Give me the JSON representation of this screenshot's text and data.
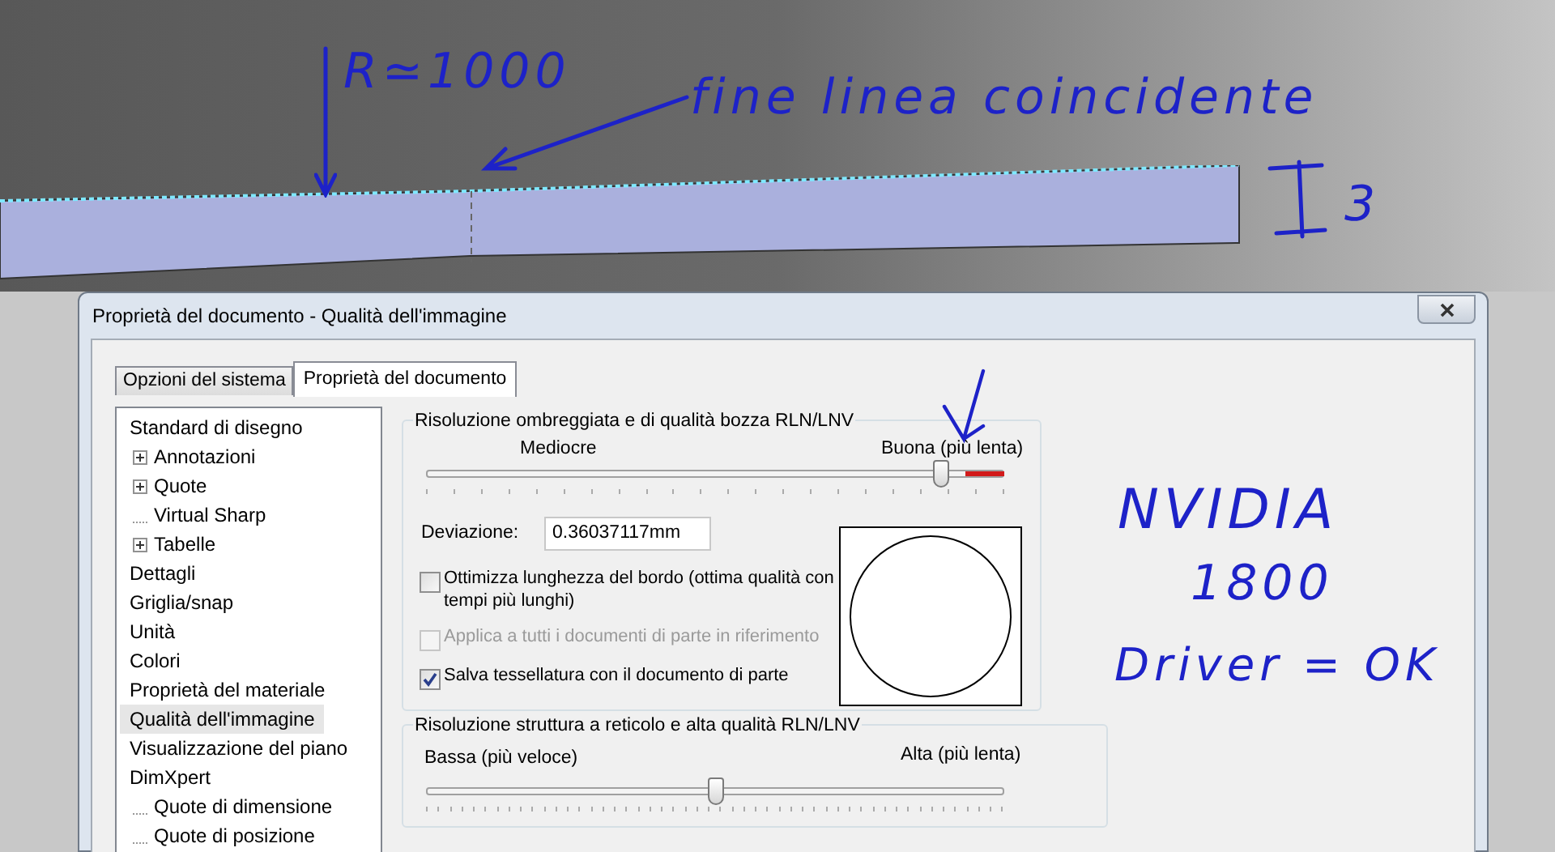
{
  "viewport_annotations": [
    "R≃1000",
    "fine linea coincidente",
    "3"
  ],
  "side_annotations": [
    "NVIDIA",
    "1800",
    "Driver = OK"
  ],
  "dialog": {
    "title": "Proprietà del documento - Qualità dell'immagine",
    "tabs": [
      {
        "label": "Opzioni del sistema",
        "selected": false
      },
      {
        "label": "Proprietà del documento",
        "selected": true
      }
    ],
    "tree": [
      {
        "label": "Standard di disegno",
        "selected": false,
        "children": [
          {
            "label": "Annotazioni",
            "kind": "collapsed"
          },
          {
            "label": "Quote",
            "kind": "collapsed"
          },
          {
            "label": "Virtual Sharp",
            "kind": "leaf"
          },
          {
            "label": "Tabelle",
            "kind": "collapsed"
          }
        ]
      },
      {
        "label": "Dettagli",
        "selected": false
      },
      {
        "label": "Griglia/snap",
        "selected": false
      },
      {
        "label": "Unità",
        "selected": false
      },
      {
        "label": "Colori",
        "selected": false
      },
      {
        "label": "Proprietà del materiale",
        "selected": false
      },
      {
        "label": "Qualità dell'immagine",
        "selected": true
      },
      {
        "label": "Visualizzazione del piano",
        "selected": false
      },
      {
        "label": "DimXpert",
        "selected": false,
        "children": [
          {
            "label": "Quote di dimensione",
            "kind": "leaf"
          },
          {
            "label": "Quote di posizione",
            "kind": "leaf"
          }
        ]
      }
    ],
    "shaded_group": {
      "legend": "Risoluzione ombreggiata e di qualità bozza RLN/LNV",
      "left_label": "Mediocre",
      "right_label": "Buona (più lenta)",
      "level": 0.89,
      "deviation_label": "Deviazione:",
      "deviation_value": "0.36037117mm",
      "checkboxes": [
        {
          "label": "Ottimizza lunghezza del bordo (ottima qualità con tempi più lunghi)",
          "checked": false,
          "disabled": false
        },
        {
          "label": "Applica a tutti i documenti di parte in riferimento",
          "checked": false,
          "disabled": true
        },
        {
          "label": "Salva tessellatura con il documento di parte",
          "checked": true,
          "disabled": false
        }
      ]
    },
    "wireframe_group": {
      "legend": "Risoluzione struttura a reticolo e alta qualità RLN/LNV",
      "left_label": "Bassa (più veloce)",
      "right_label": "Alta (più lenta)",
      "level": 0.5
    }
  }
}
